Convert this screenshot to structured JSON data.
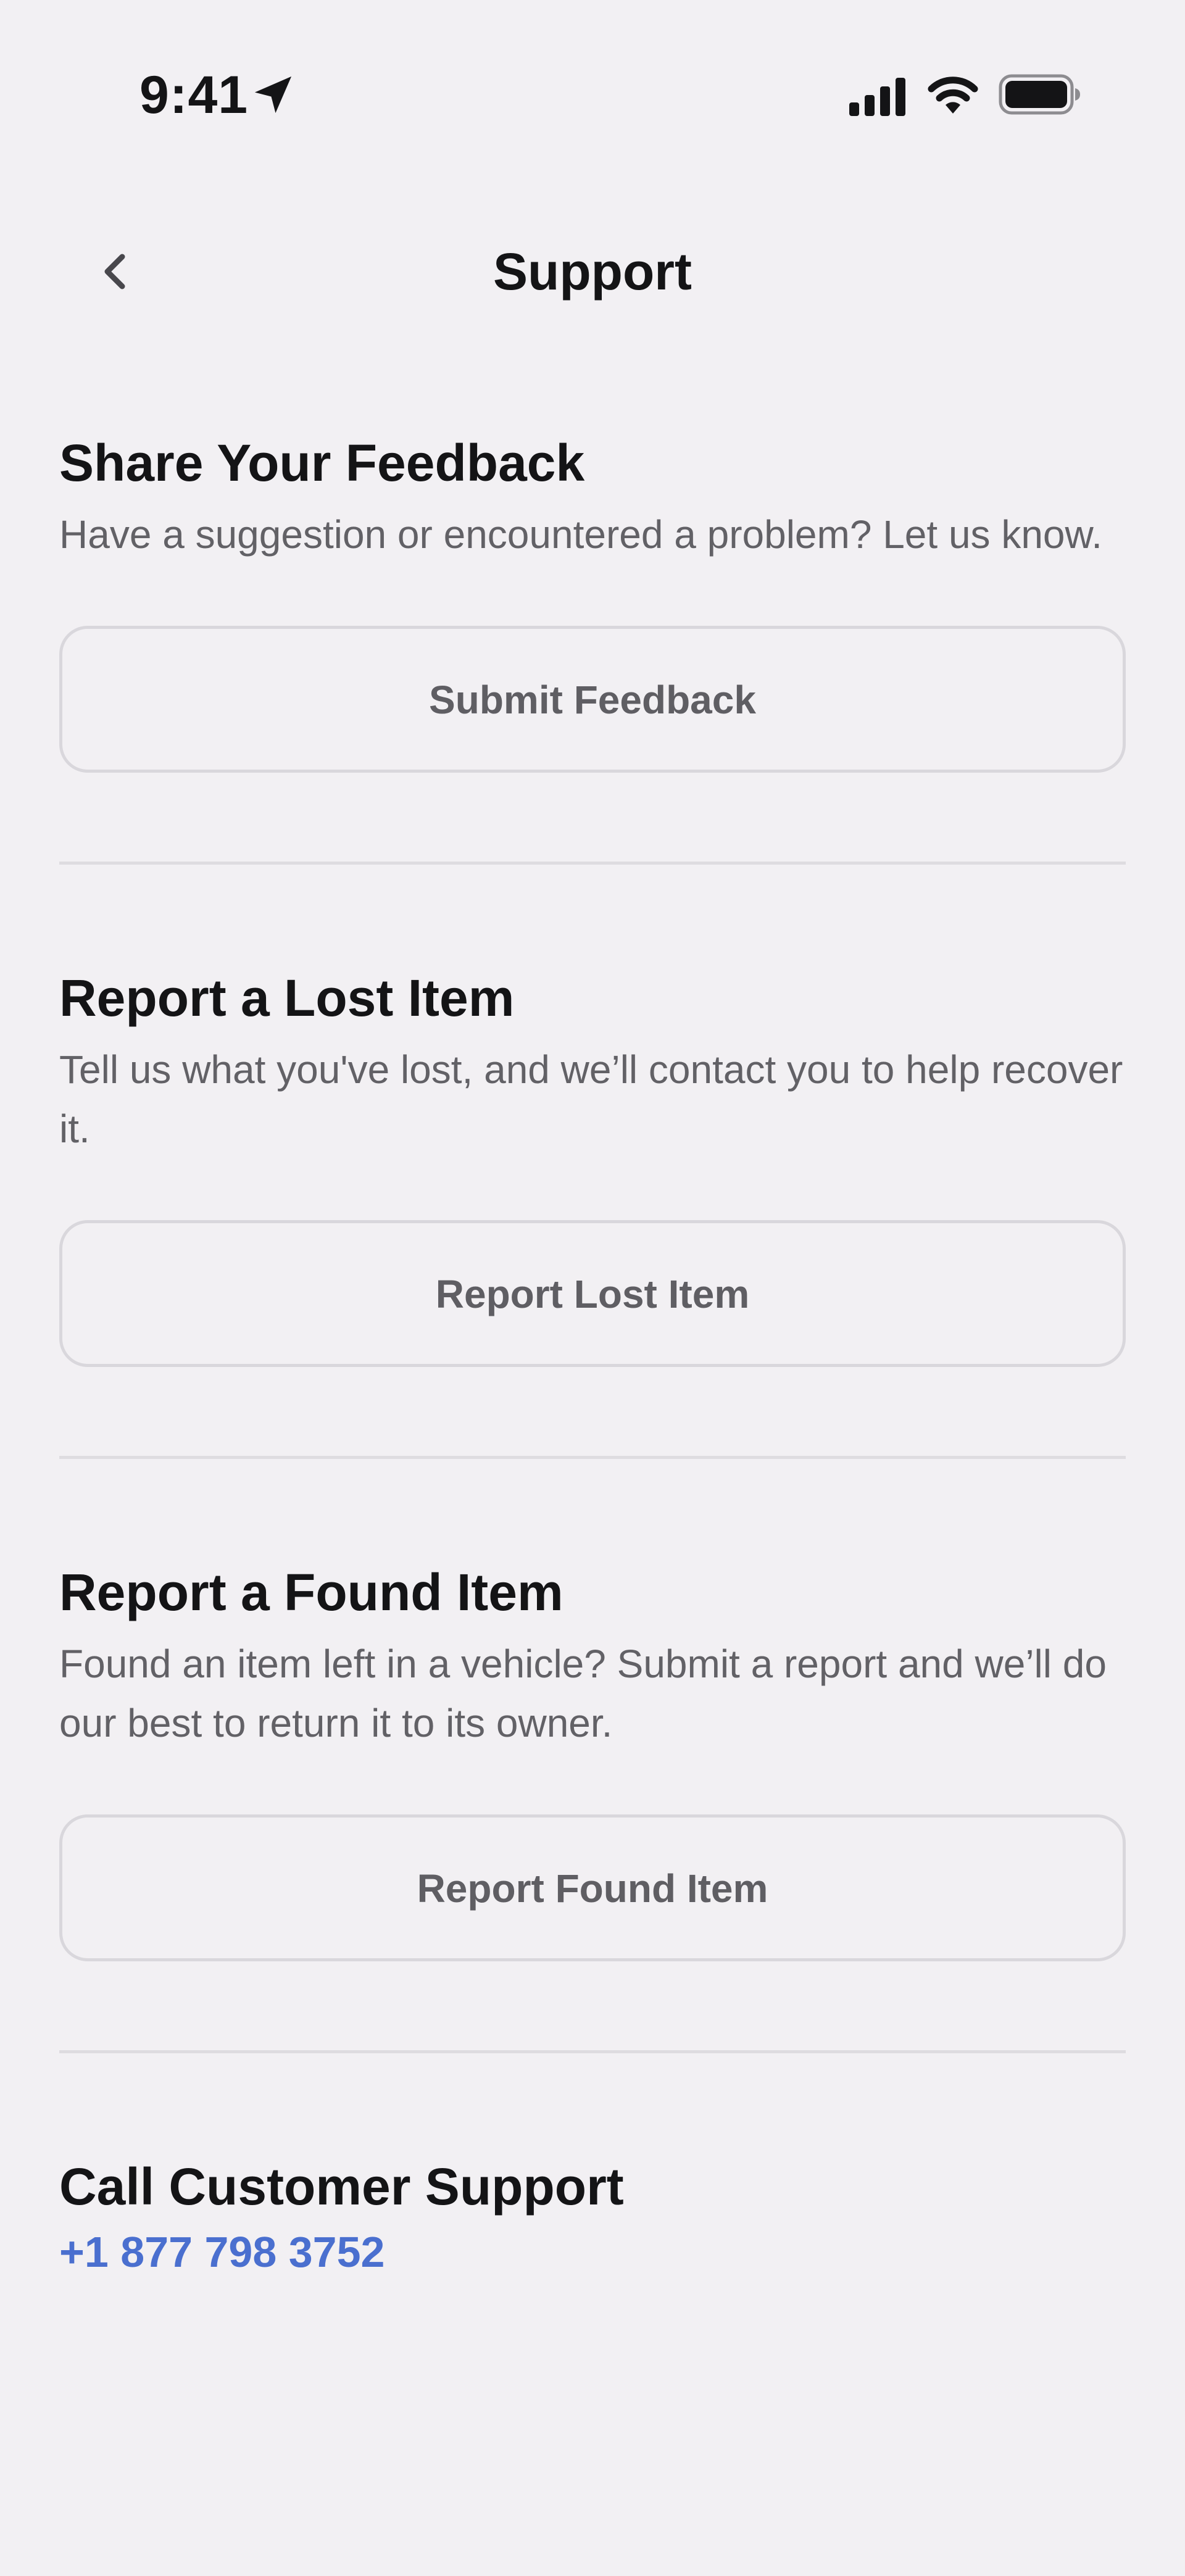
{
  "status_bar": {
    "time": "9:41",
    "icons": [
      "location-arrow-icon",
      "cellular-signal-icon",
      "wifi-icon",
      "battery-icon"
    ]
  },
  "nav": {
    "title": "Support",
    "back_icon": "chevron-left-icon"
  },
  "sections": [
    {
      "title": "Share Your Feedback",
      "description": "Have a suggestion or encountered a problem? Let us know.",
      "button_label": "Submit Feedback"
    },
    {
      "title": "Report a Lost Item",
      "description": "Tell us what you've lost, and we’ll contact you to help recover it.",
      "button_label": "Report Lost Item"
    },
    {
      "title": "Report a Found Item",
      "description": "Found an item left in a vehicle? Submit a report and we’ll do our best to return it to its owner.",
      "button_label": "Report Found Item"
    }
  ],
  "call_support": {
    "title": "Call Customer Support",
    "phone": "+1 877 798 3752"
  },
  "colors": {
    "background": "#f2f0f3",
    "text_primary": "#141416",
    "text_secondary": "#626166",
    "link": "#4a6fcf",
    "border": "#d9d7dc"
  }
}
